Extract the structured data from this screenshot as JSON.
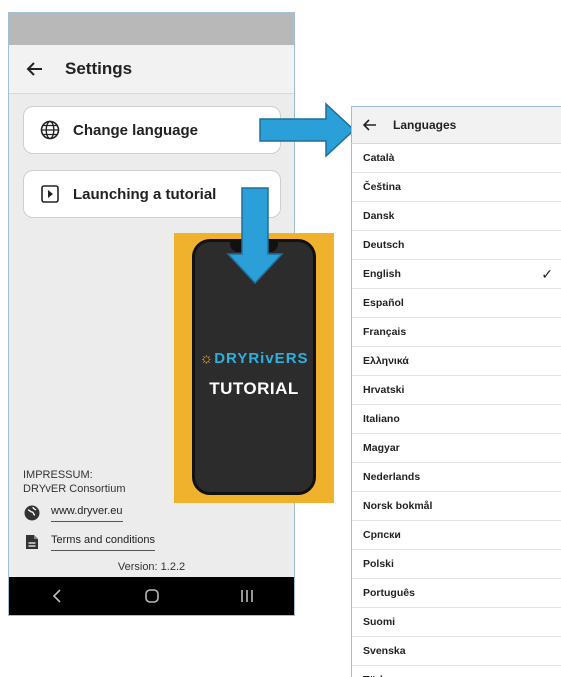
{
  "settings": {
    "title": "Settings",
    "cards": [
      {
        "label": "Change language",
        "icon": "globe-icon"
      },
      {
        "label": "Launching a tutorial",
        "icon": "play-icon"
      }
    ],
    "impressum_title": "IMPRESSUM:",
    "impressum_org": "DRYvER Consortium",
    "website": "www.dryver.eu",
    "terms": "Terms and conditions",
    "version": "Version: 1.2.2"
  },
  "tutorial": {
    "brand_prefix": "DRY",
    "brand_suffix": "RivERS",
    "label": "TUTORIAL"
  },
  "languages": {
    "title": "Languages",
    "selected": "English",
    "items": [
      "Català",
      "Čeština",
      "Dansk",
      "Deutsch",
      "English",
      "Español",
      "Français",
      "Ελληνικά",
      "Hrvatski",
      "Italiano",
      "Magyar",
      "Nederlands",
      "Norsk bokmål",
      "Српски",
      "Polski",
      "Português",
      "Suomi",
      "Svenska",
      "Türkçe"
    ]
  },
  "colors": {
    "arrow": "#2a9fd8",
    "tutorial_frame": "#f0b12d",
    "brand": "#2bb0e0"
  }
}
